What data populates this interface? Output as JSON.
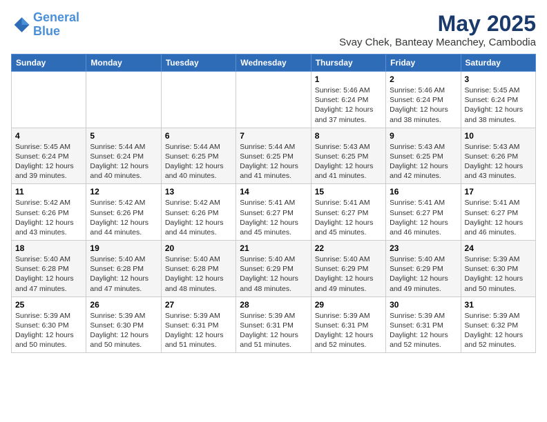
{
  "logo": {
    "line1": "General",
    "line2": "Blue"
  },
  "title": "May 2025",
  "subtitle": "Svay Chek, Banteay Meanchey, Cambodia",
  "days_of_week": [
    "Sunday",
    "Monday",
    "Tuesday",
    "Wednesday",
    "Thursday",
    "Friday",
    "Saturday"
  ],
  "weeks": [
    [
      {
        "day": "",
        "info": ""
      },
      {
        "day": "",
        "info": ""
      },
      {
        "day": "",
        "info": ""
      },
      {
        "day": "",
        "info": ""
      },
      {
        "day": "1",
        "info": "Sunrise: 5:46 AM\nSunset: 6:24 PM\nDaylight: 12 hours\nand 37 minutes."
      },
      {
        "day": "2",
        "info": "Sunrise: 5:46 AM\nSunset: 6:24 PM\nDaylight: 12 hours\nand 38 minutes."
      },
      {
        "day": "3",
        "info": "Sunrise: 5:45 AM\nSunset: 6:24 PM\nDaylight: 12 hours\nand 38 minutes."
      }
    ],
    [
      {
        "day": "4",
        "info": "Sunrise: 5:45 AM\nSunset: 6:24 PM\nDaylight: 12 hours\nand 39 minutes."
      },
      {
        "day": "5",
        "info": "Sunrise: 5:44 AM\nSunset: 6:24 PM\nDaylight: 12 hours\nand 40 minutes."
      },
      {
        "day": "6",
        "info": "Sunrise: 5:44 AM\nSunset: 6:25 PM\nDaylight: 12 hours\nand 40 minutes."
      },
      {
        "day": "7",
        "info": "Sunrise: 5:44 AM\nSunset: 6:25 PM\nDaylight: 12 hours\nand 41 minutes."
      },
      {
        "day": "8",
        "info": "Sunrise: 5:43 AM\nSunset: 6:25 PM\nDaylight: 12 hours\nand 41 minutes."
      },
      {
        "day": "9",
        "info": "Sunrise: 5:43 AM\nSunset: 6:25 PM\nDaylight: 12 hours\nand 42 minutes."
      },
      {
        "day": "10",
        "info": "Sunrise: 5:43 AM\nSunset: 6:26 PM\nDaylight: 12 hours\nand 43 minutes."
      }
    ],
    [
      {
        "day": "11",
        "info": "Sunrise: 5:42 AM\nSunset: 6:26 PM\nDaylight: 12 hours\nand 43 minutes."
      },
      {
        "day": "12",
        "info": "Sunrise: 5:42 AM\nSunset: 6:26 PM\nDaylight: 12 hours\nand 44 minutes."
      },
      {
        "day": "13",
        "info": "Sunrise: 5:42 AM\nSunset: 6:26 PM\nDaylight: 12 hours\nand 44 minutes."
      },
      {
        "day": "14",
        "info": "Sunrise: 5:41 AM\nSunset: 6:27 PM\nDaylight: 12 hours\nand 45 minutes."
      },
      {
        "day": "15",
        "info": "Sunrise: 5:41 AM\nSunset: 6:27 PM\nDaylight: 12 hours\nand 45 minutes."
      },
      {
        "day": "16",
        "info": "Sunrise: 5:41 AM\nSunset: 6:27 PM\nDaylight: 12 hours\nand 46 minutes."
      },
      {
        "day": "17",
        "info": "Sunrise: 5:41 AM\nSunset: 6:27 PM\nDaylight: 12 hours\nand 46 minutes."
      }
    ],
    [
      {
        "day": "18",
        "info": "Sunrise: 5:40 AM\nSunset: 6:28 PM\nDaylight: 12 hours\nand 47 minutes."
      },
      {
        "day": "19",
        "info": "Sunrise: 5:40 AM\nSunset: 6:28 PM\nDaylight: 12 hours\nand 47 minutes."
      },
      {
        "day": "20",
        "info": "Sunrise: 5:40 AM\nSunset: 6:28 PM\nDaylight: 12 hours\nand 48 minutes."
      },
      {
        "day": "21",
        "info": "Sunrise: 5:40 AM\nSunset: 6:29 PM\nDaylight: 12 hours\nand 48 minutes."
      },
      {
        "day": "22",
        "info": "Sunrise: 5:40 AM\nSunset: 6:29 PM\nDaylight: 12 hours\nand 49 minutes."
      },
      {
        "day": "23",
        "info": "Sunrise: 5:40 AM\nSunset: 6:29 PM\nDaylight: 12 hours\nand 49 minutes."
      },
      {
        "day": "24",
        "info": "Sunrise: 5:39 AM\nSunset: 6:30 PM\nDaylight: 12 hours\nand 50 minutes."
      }
    ],
    [
      {
        "day": "25",
        "info": "Sunrise: 5:39 AM\nSunset: 6:30 PM\nDaylight: 12 hours\nand 50 minutes."
      },
      {
        "day": "26",
        "info": "Sunrise: 5:39 AM\nSunset: 6:30 PM\nDaylight: 12 hours\nand 50 minutes."
      },
      {
        "day": "27",
        "info": "Sunrise: 5:39 AM\nSunset: 6:31 PM\nDaylight: 12 hours\nand 51 minutes."
      },
      {
        "day": "28",
        "info": "Sunrise: 5:39 AM\nSunset: 6:31 PM\nDaylight: 12 hours\nand 51 minutes."
      },
      {
        "day": "29",
        "info": "Sunrise: 5:39 AM\nSunset: 6:31 PM\nDaylight: 12 hours\nand 52 minutes."
      },
      {
        "day": "30",
        "info": "Sunrise: 5:39 AM\nSunset: 6:31 PM\nDaylight: 12 hours\nand 52 minutes."
      },
      {
        "day": "31",
        "info": "Sunrise: 5:39 AM\nSunset: 6:32 PM\nDaylight: 12 hours\nand 52 minutes."
      }
    ]
  ]
}
